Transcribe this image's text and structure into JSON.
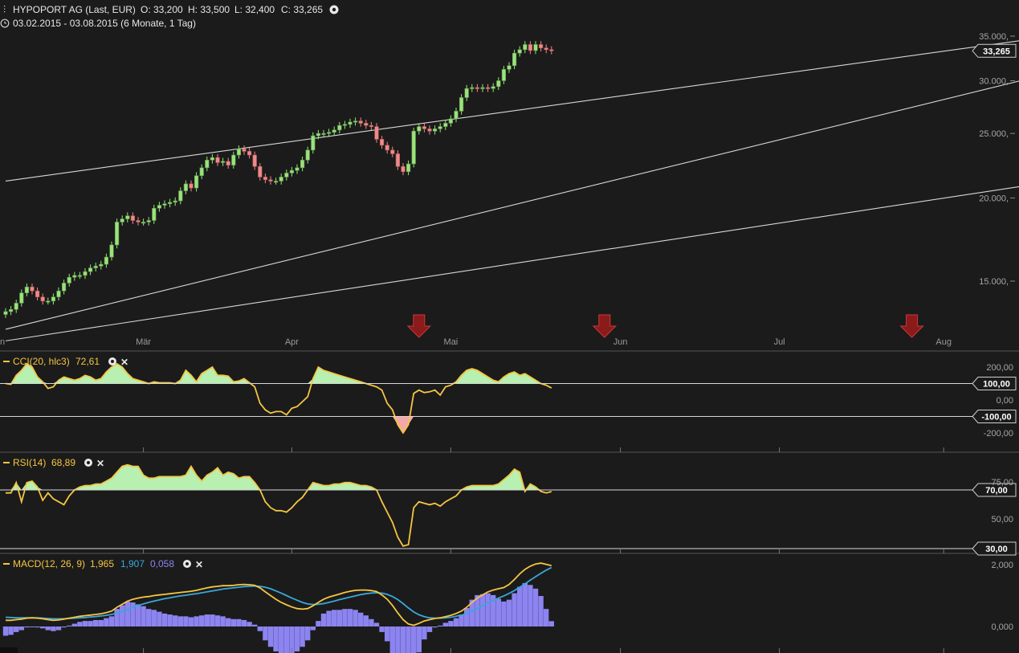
{
  "header": {
    "title": "HYPOPORT AG (Last, EUR)",
    "o": "O: 33,200",
    "h": "H: 33,500",
    "l": "L: 32,400",
    "c": "C: 33,265",
    "period": "03.02.2015 - 03.08.2015 (6 Monate, 1 Tag)"
  },
  "colors": {
    "background": "#1b1b1b",
    "up": "#9be27c",
    "down": "#f08a8a",
    "line": "#f5c542",
    "signal": "#3aa7d9",
    "hist": "#8c84f0",
    "area_pos": "#b7f0b0",
    "area_neg": "#f4a8a8",
    "arrow": "#8b1a1a"
  },
  "chart_data": [
    {
      "type": "candlestick",
      "name": "HYPOPORT AG",
      "last": "33,265",
      "y_ticks": [
        "15.000",
        "20.000",
        "25.000",
        "30.000",
        "35.000"
      ],
      "y_tick_labels": [
        "15.000,",
        "20.000,",
        "25.000,",
        "30.000,",
        "35.000,"
      ],
      "x_labels": [
        "Mär",
        "Apr",
        "Mai",
        "Jun",
        "Jul",
        "Aug"
      ],
      "x_label_days": [
        26,
        54,
        84,
        116,
        146,
        177
      ],
      "ylim": [
        11000,
        35500
      ],
      "close": [
        13.5,
        13.6,
        13.9,
        14.4,
        14.7,
        14.5,
        14.2,
        14.0,
        14.0,
        14.2,
        14.5,
        14.9,
        15.2,
        15.3,
        15.3,
        15.5,
        15.7,
        15.8,
        15.9,
        16.3,
        17.0,
        18.4,
        18.6,
        18.8,
        18.5,
        18.4,
        18.4,
        18.5,
        19.3,
        19.5,
        19.6,
        19.7,
        19.8,
        20.5,
        21.0,
        20.7,
        21.6,
        22.2,
        22.8,
        23.0,
        22.6,
        22.7,
        22.4,
        23.2,
        23.7,
        23.5,
        23.2,
        22.3,
        21.5,
        21.3,
        21.2,
        21.2,
        21.5,
        21.8,
        22.0,
        22.2,
        22.8,
        23.6,
        24.8,
        25.0,
        25.0,
        25.1,
        25.3,
        25.7,
        25.8,
        26.0,
        26.1,
        25.9,
        25.7,
        25.6,
        24.5,
        24.0,
        23.6,
        23.3,
        22.3,
        21.9,
        22.5,
        25.2,
        25.6,
        25.4,
        25.2,
        25.4,
        25.6,
        25.9,
        26.3,
        27.0,
        28.3,
        29.2,
        29.3,
        29.2,
        29.3,
        29.2,
        29.4,
        30.0,
        31.2,
        31.6,
        33.0,
        33.4,
        34.0,
        33.3,
        34.0,
        33.6,
        33.4,
        33.265
      ],
      "trendlines": [
        {
          "from": [
            0,
            21200
          ],
          "to": [
            193,
            34600
          ]
        },
        {
          "from": [
            0,
            12700
          ],
          "to": [
            193,
            30200
          ]
        },
        {
          "from": [
            0,
            12200
          ],
          "to": [
            193,
            20900
          ]
        }
      ],
      "sell_signals_day": [
        78,
        113,
        171
      ]
    },
    {
      "type": "line",
      "name": "CCI(20, hlc3)",
      "value": "72,61",
      "levels": [
        100,
        -100
      ],
      "level_labels": [
        "100,00",
        "-100,00"
      ],
      "y_tick_labels": [
        "200,00",
        "100,00",
        "0,00",
        "-100,00",
        "-200,00"
      ],
      "ylim": [
        -280,
        280
      ],
      "values": [
        100,
        95,
        150,
        180,
        220,
        200,
        140,
        110,
        70,
        80,
        120,
        140,
        130,
        120,
        130,
        150,
        140,
        120,
        130,
        170,
        200,
        220,
        200,
        160,
        130,
        120,
        110,
        100,
        110,
        105,
        105,
        105,
        100,
        120,
        180,
        150,
        110,
        160,
        180,
        200,
        150,
        150,
        145,
        110,
        115,
        130,
        105,
        80,
        -20,
        -60,
        -80,
        -70,
        -70,
        -90,
        -50,
        -40,
        -10,
        20,
        130,
        200,
        180,
        170,
        160,
        150,
        140,
        130,
        120,
        110,
        100,
        90,
        80,
        60,
        -20,
        -60,
        -150,
        -200,
        -150,
        40,
        60,
        45,
        50,
        60,
        30,
        80,
        90,
        110,
        150,
        180,
        190,
        180,
        160,
        140,
        120,
        110,
        140,
        160,
        170,
        150,
        160,
        140,
        120,
        100,
        90,
        72.61
      ]
    },
    {
      "type": "line",
      "name": "RSI(14)",
      "value": "68,89",
      "levels": [
        70,
        30
      ],
      "level_labels": [
        "70,00",
        "30,00"
      ],
      "y_tick_labels": [
        "75,00",
        "50,00"
      ],
      "ylim": [
        28,
        92
      ],
      "values": [
        68,
        68,
        75,
        62,
        75,
        76,
        72,
        63,
        68,
        64,
        62,
        60,
        66,
        70,
        72,
        73,
        73,
        74,
        74,
        76,
        78,
        82,
        86,
        87,
        86,
        86,
        80,
        78,
        78,
        79,
        79,
        79,
        79,
        79,
        80,
        86,
        80,
        76,
        80,
        82,
        85,
        80,
        82,
        81,
        78,
        79,
        79,
        75,
        70,
        62,
        58,
        56,
        56,
        55,
        58,
        62,
        65,
        70,
        75,
        74,
        73,
        73,
        74,
        74,
        75,
        75,
        74,
        73,
        73,
        72,
        70,
        62,
        55,
        48,
        38,
        32,
        33,
        58,
        62,
        61,
        60,
        61,
        59,
        62,
        64,
        66,
        70,
        72,
        73,
        73,
        73,
        73,
        73,
        74,
        77,
        80,
        84,
        82,
        69,
        74,
        72,
        69,
        68,
        68.89
      ]
    },
    {
      "type": "line",
      "name": "MACD(12, 26, 9)",
      "value": "1,965",
      "signal_value": "1,907",
      "hist_value": "0,058",
      "y_tick_labels": [
        "2,000",
        "0,000"
      ],
      "ylim": [
        -0.3,
        2.15
      ],
      "macd": [
        0.2,
        0.2,
        0.22,
        0.24,
        0.27,
        0.28,
        0.27,
        0.25,
        0.22,
        0.2,
        0.21,
        0.24,
        0.27,
        0.3,
        0.33,
        0.35,
        0.37,
        0.39,
        0.41,
        0.45,
        0.5,
        0.62,
        0.72,
        0.82,
        0.88,
        0.92,
        0.95,
        0.97,
        1.0,
        1.02,
        1.04,
        1.06,
        1.08,
        1.1,
        1.12,
        1.14,
        1.17,
        1.21,
        1.25,
        1.28,
        1.3,
        1.32,
        1.32,
        1.33,
        1.35,
        1.36,
        1.35,
        1.33,
        1.25,
        1.12,
        1.0,
        0.88,
        0.78,
        0.7,
        0.63,
        0.58,
        0.56,
        0.58,
        0.67,
        0.78,
        0.88,
        0.95,
        1.0,
        1.05,
        1.1,
        1.14,
        1.17,
        1.18,
        1.18,
        1.16,
        1.13,
        1.02,
        0.88,
        0.68,
        0.44,
        0.22,
        0.08,
        0.04,
        0.1,
        0.18,
        0.22,
        0.26,
        0.28,
        0.32,
        0.36,
        0.42,
        0.5,
        0.62,
        0.78,
        0.92,
        1.02,
        1.12,
        1.18,
        1.22,
        1.26,
        1.36,
        1.52,
        1.7,
        1.85,
        1.95,
        2.02,
        2.05,
        2.01,
        1.965
      ],
      "signal": [
        0.3,
        0.29,
        0.28,
        0.28,
        0.28,
        0.28,
        0.28,
        0.27,
        0.26,
        0.25,
        0.25,
        0.25,
        0.26,
        0.27,
        0.28,
        0.29,
        0.31,
        0.32,
        0.34,
        0.36,
        0.39,
        0.43,
        0.49,
        0.55,
        0.62,
        0.68,
        0.73,
        0.78,
        0.82,
        0.86,
        0.9,
        0.93,
        0.96,
        0.99,
        1.01,
        1.04,
        1.06,
        1.09,
        1.12,
        1.15,
        1.18,
        1.21,
        1.23,
        1.25,
        1.27,
        1.29,
        1.3,
        1.31,
        1.3,
        1.27,
        1.22,
        1.15,
        1.08,
        1.0,
        0.92,
        0.85,
        0.78,
        0.73,
        0.71,
        0.72,
        0.74,
        0.78,
        0.82,
        0.87,
        0.91,
        0.95,
        0.99,
        1.03,
        1.06,
        1.08,
        1.09,
        1.08,
        1.04,
        0.97,
        0.87,
        0.74,
        0.6,
        0.47,
        0.38,
        0.32,
        0.28,
        0.27,
        0.27,
        0.28,
        0.3,
        0.33,
        0.37,
        0.42,
        0.49,
        0.58,
        0.67,
        0.76,
        0.84,
        0.92,
        0.99,
        1.07,
        1.16,
        1.27,
        1.38,
        1.5,
        1.61,
        1.72,
        1.82,
        1.907
      ]
    }
  ]
}
